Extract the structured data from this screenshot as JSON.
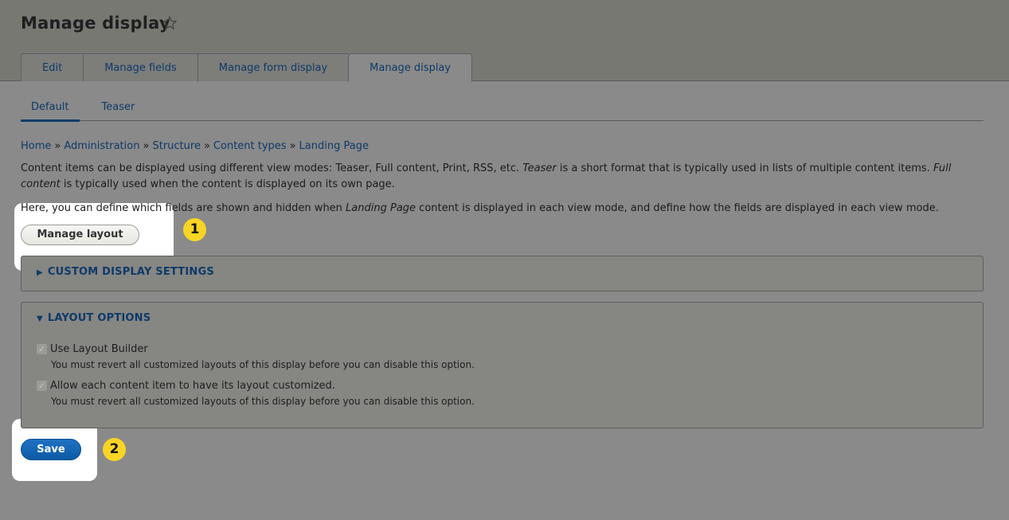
{
  "header": {
    "title": "Manage display",
    "favorite_icon": "star-outline-icon"
  },
  "primary_tabs": [
    {
      "label": "Edit",
      "active": false
    },
    {
      "label": "Manage fields",
      "active": false
    },
    {
      "label": "Manage form display",
      "active": false
    },
    {
      "label": "Manage display",
      "active": true
    }
  ],
  "secondary_tabs": [
    {
      "label": "Default",
      "active": true
    },
    {
      "label": "Teaser",
      "active": false
    }
  ],
  "breadcrumb": {
    "separator": "»",
    "items": [
      "Home",
      "Administration",
      "Structure",
      "Content types",
      "Landing Page"
    ]
  },
  "description": {
    "p1_a": "Content items can be displayed using different view modes: Teaser, Full content, Print, RSS, etc. ",
    "p1_em1": "Teaser",
    "p1_b": " is a short format that is typically used in lists of multiple content items. ",
    "p1_em2": "Full content",
    "p1_c": " is typically used when the content is displayed on its own page.",
    "p2_a": "Here, you can define which fields are shown and hidden when ",
    "p2_em": "Landing Page",
    "p2_b": " content is displayed in each view mode, and define how the fields are displayed in each view mode."
  },
  "buttons": {
    "manage_layout": "Manage layout",
    "save": "Save"
  },
  "markers": {
    "one": "1",
    "two": "2",
    "color": "#f8d524"
  },
  "sections": {
    "custom_display": {
      "label": "Custom display settings",
      "expanded": false,
      "icon": "triangle-right-icon"
    },
    "layout_options": {
      "label": "Layout options",
      "expanded": true,
      "icon": "triangle-down-icon",
      "options": [
        {
          "label": "Use Layout Builder",
          "checked": true,
          "disabled": true,
          "help": "You must revert all customized layouts of this display before you can disable this option."
        },
        {
          "label": "Allow each content item to have its layout customized.",
          "checked": true,
          "disabled": true,
          "help": "You must revert all customized layouts of this display before you can disable this option."
        }
      ]
    }
  },
  "colors": {
    "link": "#0e3a68",
    "primary_button": "#0d5aa5",
    "overlay_bg": "#8a8a8a"
  }
}
